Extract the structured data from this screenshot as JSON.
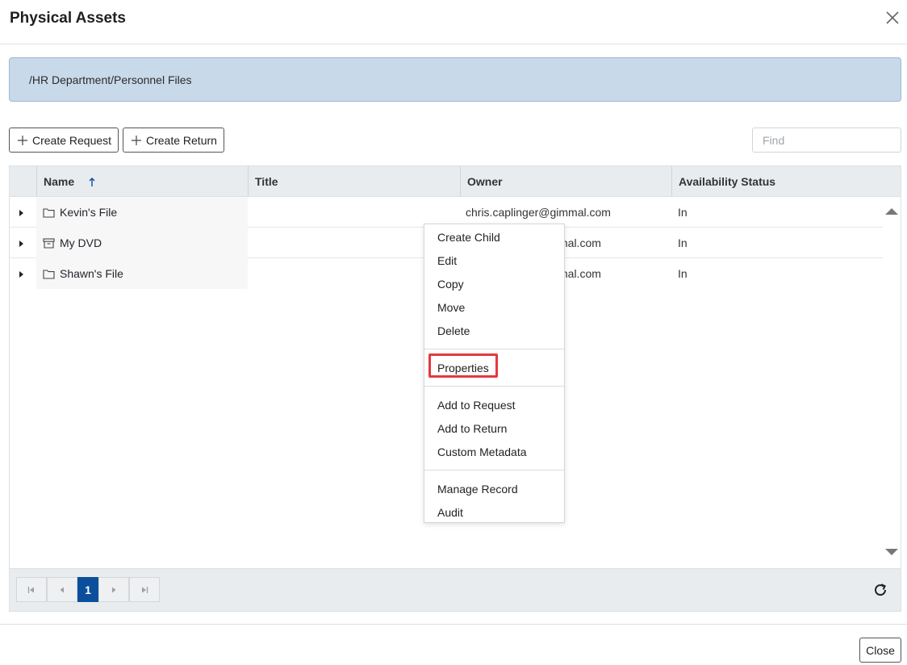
{
  "dialog": {
    "title": "Physical Assets",
    "close_label": "Close"
  },
  "breadcrumb": {
    "path": "/HR Department/Personnel Files"
  },
  "toolbar": {
    "create_request_label": "Create Request",
    "create_return_label": "Create Return",
    "find_placeholder": "Find"
  },
  "grid": {
    "columns": [
      "Name",
      "Title",
      "Owner",
      "Availability Status"
    ],
    "sort": {
      "column": "Name",
      "direction": "ascending"
    },
    "rows": [
      {
        "name": "Kevin's File",
        "icon": "folder-icon",
        "title": "",
        "owner": "chris.caplinger@gimmal.com",
        "status": "In"
      },
      {
        "name": "My DVD",
        "icon": "archive-box-icon",
        "title": "",
        "owner": "mal.com",
        "status": "In"
      },
      {
        "name": "Shawn's File",
        "icon": "folder-icon",
        "title": "",
        "owner": "mal.com",
        "status": "In"
      }
    ]
  },
  "pager": {
    "current_page": "1"
  },
  "context_menu": {
    "items": [
      "Create Child",
      "Edit",
      "Copy",
      "Move",
      "Delete",
      "Properties",
      "Add to Request",
      "Add to Return",
      "Custom Metadata",
      "Manage Record",
      "Audit"
    ],
    "highlighted": "Properties",
    "highlight_color": "#e5393e"
  },
  "colors": {
    "breadcrumb_bg": "#c8d9ea",
    "pager_active": "#0b4f9c",
    "header_bg": "#e9ecef"
  }
}
